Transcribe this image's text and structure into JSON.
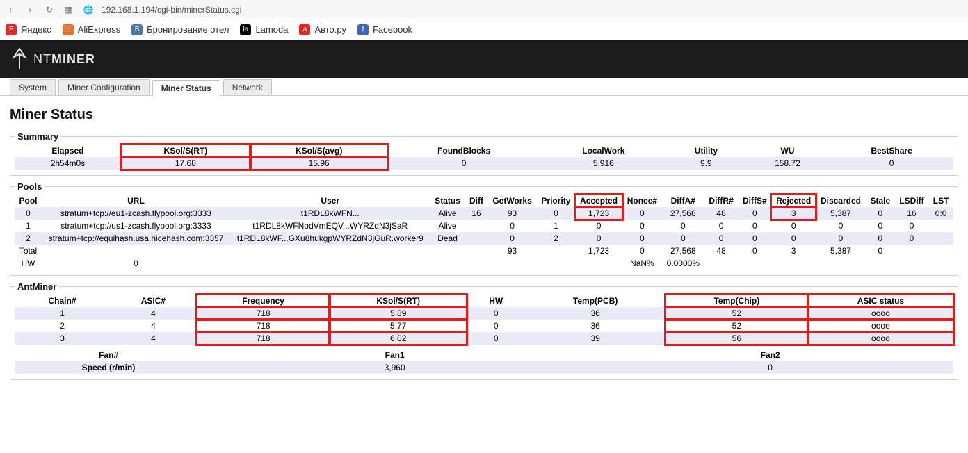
{
  "browser": {
    "url": "192.168.1.194/cgi-bin/minerStatus.cgi"
  },
  "bookmarks": [
    {
      "label": "Яндекс",
      "icon": "y"
    },
    {
      "label": "AliExpress",
      "icon": "a"
    },
    {
      "label": "Бронирование отел",
      "icon": "v"
    },
    {
      "label": "Lamoda",
      "icon": "l"
    },
    {
      "label": "Авто.ру",
      "icon": "av"
    },
    {
      "label": "Facebook",
      "icon": "f"
    }
  ],
  "brand": {
    "prefix": "NT",
    "name": "MINER"
  },
  "tabs": [
    {
      "label": "System",
      "active": false
    },
    {
      "label": "Miner Configuration",
      "active": false
    },
    {
      "label": "Miner Status",
      "active": true
    },
    {
      "label": "Network",
      "active": false
    }
  ],
  "title": "Miner Status",
  "summary": {
    "legend": "Summary",
    "headers": [
      "Elapsed",
      "KSol/S(RT)",
      "KSol/S(avg)",
      "FoundBlocks",
      "LocalWork",
      "Utility",
      "WU",
      "BestShare"
    ],
    "row": [
      "2h54m0s",
      "17.68",
      "15.96",
      "0",
      "5,916",
      "9.9",
      "158.72",
      "0"
    ]
  },
  "pools": {
    "legend": "Pools",
    "headers": [
      "Pool",
      "URL",
      "User",
      "Status",
      "Diff",
      "GetWorks",
      "Priority",
      "Accepted",
      "Nonce#",
      "DiffA#",
      "DiffR#",
      "DiffS#",
      "Rejected",
      "Discarded",
      "Stale",
      "LSDiff",
      "LST"
    ],
    "rows": [
      [
        "0",
        "stratum+tcp://eu1-zcash.flypool.org:3333",
        "t1RDL8kWFN...",
        "Alive",
        "16",
        "93",
        "0",
        "1,723",
        "0",
        "27,568",
        "48",
        "0",
        "3",
        "5,387",
        "0",
        "16",
        "0:0"
      ],
      [
        "1",
        "stratum+tcp://us1-zcash.flypool.org:3333",
        "t1RDL8kWFNodVmEQV...WYRZdN3jSaR",
        "Alive",
        "",
        "0",
        "1",
        "0",
        "0",
        "0",
        "0",
        "0",
        "0",
        "0",
        "0",
        "0",
        ""
      ],
      [
        "2",
        "stratum+tcp://equihash.usa.nicehash.com:3357",
        "t1RDL8kWF...GXu8hukgpWYRZdN3jGuR.worker9",
        "Dead",
        "",
        "0",
        "2",
        "0",
        "0",
        "0",
        "0",
        "0",
        "0",
        "0",
        "0",
        "0",
        ""
      ]
    ],
    "total": [
      "Total",
      "",
      "",
      "",
      "",
      "93",
      "",
      "1,723",
      "0",
      "27,568",
      "48",
      "0",
      "3",
      "5,387",
      "0",
      "",
      ""
    ],
    "hw": [
      "HW",
      "0",
      "",
      "",
      "",
      "",
      "",
      "",
      "NaN%",
      "0.0000%",
      "",
      "",
      "",
      "",
      "",
      "",
      ""
    ]
  },
  "antminer": {
    "legend": "AntMiner",
    "headers": [
      "Chain#",
      "ASIC#",
      "Frequency",
      "KSol/S(RT)",
      "HW",
      "Temp(PCB)",
      "Temp(Chip)",
      "ASIC status"
    ],
    "rows": [
      [
        "1",
        "4",
        "718",
        "5.89",
        "0",
        "36",
        "52",
        "oooo"
      ],
      [
        "2",
        "4",
        "718",
        "5.77",
        "0",
        "36",
        "52",
        "oooo"
      ],
      [
        "3",
        "4",
        "718",
        "6.02",
        "0",
        "39",
        "56",
        "oooo"
      ]
    ],
    "fan_headers": [
      "Fan#",
      "Fan1",
      "Fan2"
    ],
    "fan_row": [
      "Speed (r/min)",
      "3,960",
      "0"
    ]
  }
}
